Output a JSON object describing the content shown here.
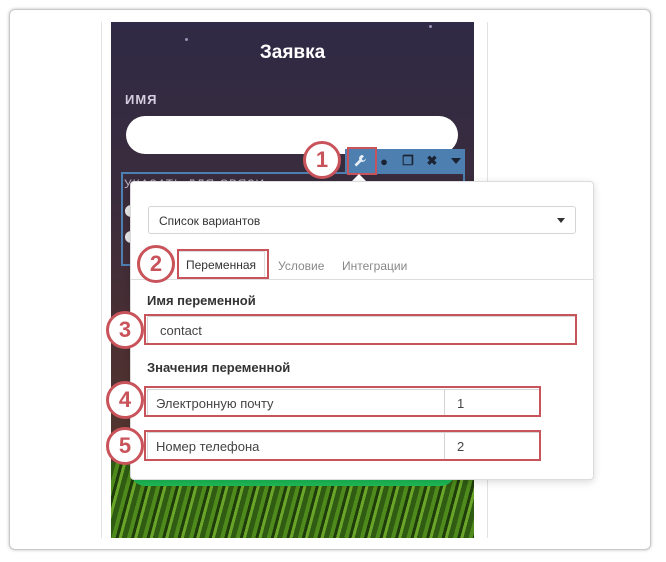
{
  "form": {
    "title": "Заявка",
    "name_label": "ИМЯ",
    "contact_label": "УКАЗАТЬ ДЛЯ СВЯЗИ"
  },
  "toolbar": {
    "icons": [
      "wrench-icon",
      "drop-icon",
      "copy-icon",
      "close-icon",
      "caret-down-icon"
    ],
    "glyphs": {
      "drop": "●",
      "copy": "❐",
      "close": "✖"
    }
  },
  "panel": {
    "select_value": "Список вариантов",
    "tabs": [
      {
        "label": "Переменная",
        "active": true
      },
      {
        "label": "Условие",
        "active": false
      },
      {
        "label": "Интеграции",
        "active": false
      }
    ],
    "variable_name_label": "Имя переменной",
    "variable_name_value": "contact",
    "variable_values_label": "Значения переменной",
    "rows": [
      {
        "key": "Электронную почту",
        "value": "1"
      },
      {
        "key": "Номер телефона",
        "value": "2"
      }
    ]
  },
  "callouts": [
    "1",
    "2",
    "3",
    "4",
    "5"
  ],
  "colors": {
    "highlight": "#c9535a",
    "toolbar": "#4d7fb0",
    "button_green": "#1db956"
  }
}
